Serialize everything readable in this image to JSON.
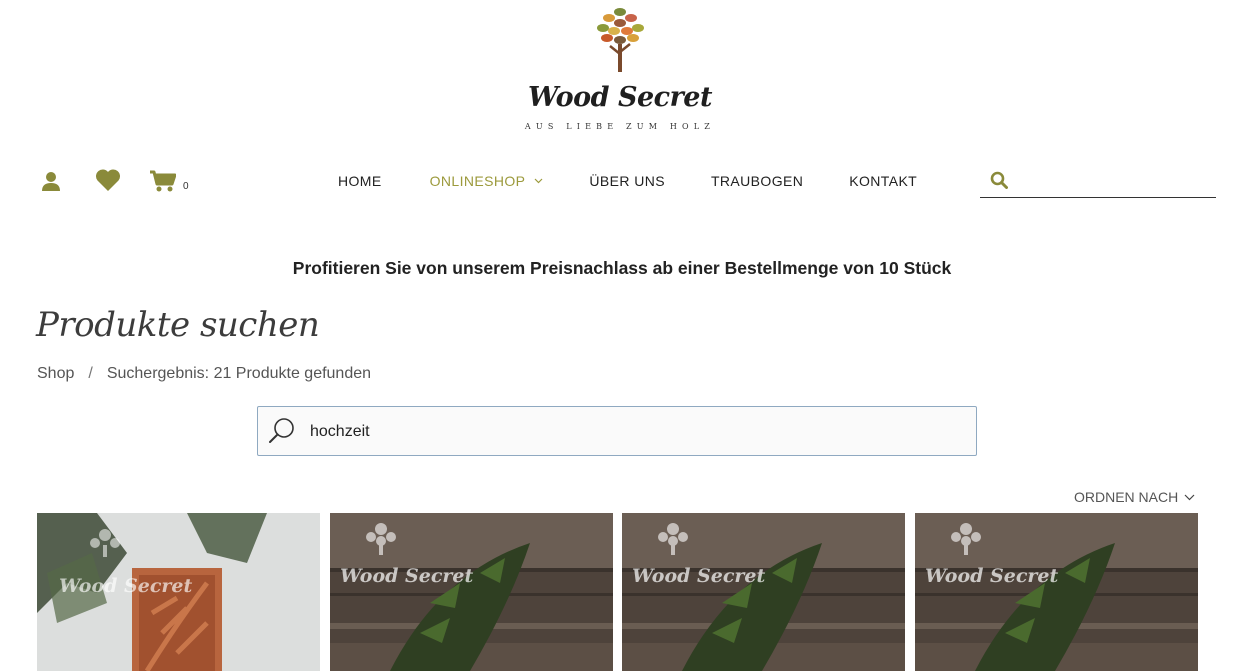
{
  "brand": {
    "name": "Wood Secret",
    "tagline": "AUS LIEBE ZUM HOLZ"
  },
  "header": {
    "cart_count": "0",
    "search_placeholder": ""
  },
  "nav": {
    "items": [
      {
        "label": "HOME",
        "active": false
      },
      {
        "label": "ONLINESHOP",
        "active": true
      },
      {
        "label": "ÜBER UNS",
        "active": false
      },
      {
        "label": "TRAUBOGEN",
        "active": false
      },
      {
        "label": "KONTAKT",
        "active": false
      }
    ]
  },
  "promo": "Profitieren Sie von unserem Preisnachlass ab einer Bestellmenge von 10 Stück",
  "page_title": "Produkte suchen",
  "breadcrumb": {
    "shop": "Shop",
    "separator": "/",
    "result": "Suchergebnis: 21 Produkte gefunden"
  },
  "search": {
    "value": "hochzeit"
  },
  "sort": {
    "label": "ORDNEN NACH"
  },
  "products": [
    {
      "watermark": "Wood Secret"
    },
    {
      "watermark": "Wood Secret"
    },
    {
      "watermark": "Wood Secret"
    },
    {
      "watermark": "Wood Secret"
    }
  ],
  "colors": {
    "accent": "#9c9a3c",
    "icon": "#8a8a3a",
    "text": "#222222"
  }
}
